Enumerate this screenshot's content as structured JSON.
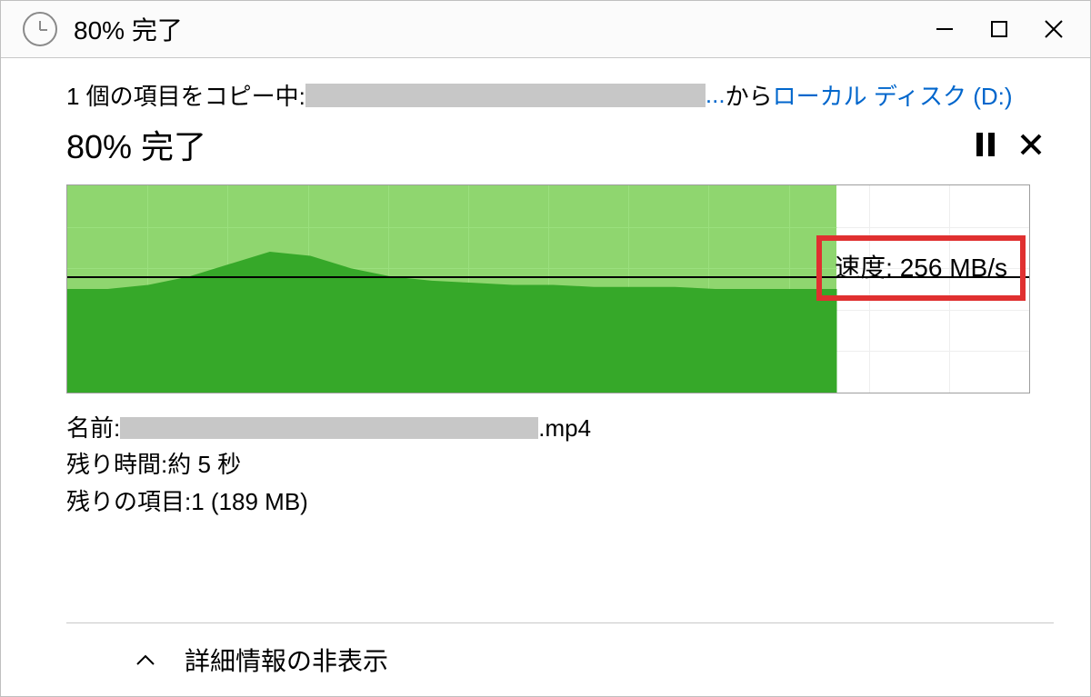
{
  "titlebar": {
    "title": "80% 完了"
  },
  "copy_line": {
    "prefix": "1 個の項目をコピー中: ",
    "ellipsis": "...",
    "from_word": " から ",
    "destination": "ローカル ディスク (D:)"
  },
  "progress": {
    "text": "80% 完了",
    "percent": 80
  },
  "chart_data": {
    "type": "area",
    "title": "",
    "xlabel": "",
    "ylabel": "",
    "ylim": [
      0,
      100
    ],
    "progress_percent": 80,
    "avg_line_percent": 56,
    "speed_label": "速度: 256 MB/s",
    "series": [
      {
        "name": "speed",
        "values": [
          50,
          50,
          52,
          56,
          62,
          68,
          66,
          60,
          56,
          54,
          53,
          52,
          52,
          51,
          51,
          51,
          50,
          50,
          50,
          50
        ]
      }
    ]
  },
  "details": {
    "name_label": "名前: ",
    "name_suffix": ".mp4",
    "time_label": "残り時間: ",
    "time_value": "約 5 秒",
    "remaining_label": "残りの項目: ",
    "remaining_value": "1 (189 MB)"
  },
  "footer": {
    "toggle_label": "詳細情報の非表示"
  },
  "colors": {
    "light_green": "#8fd66f",
    "dark_green": "#36a829",
    "link": "#0066cc",
    "highlight_border": "#e03030"
  }
}
